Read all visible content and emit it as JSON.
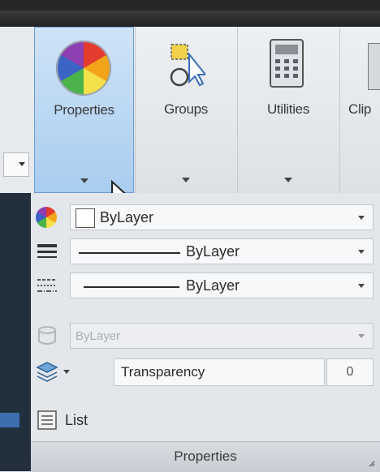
{
  "ribbon": {
    "buttons": [
      {
        "label": "Properties",
        "icon": "color-wheel-icon"
      },
      {
        "label": "Groups",
        "icon": "groups-icon"
      },
      {
        "label": "Utilities",
        "icon": "calculator-icon"
      },
      {
        "label": "Clip",
        "icon": "clipboard-icon"
      }
    ]
  },
  "panel": {
    "color": {
      "value": "ByLayer",
      "icon": "color-wheel-icon"
    },
    "lineweight": {
      "value": "ByLayer",
      "icon": "lineweight-icon"
    },
    "linetype": {
      "value": "ByLayer",
      "icon": "linetype-icon"
    },
    "plotstyle": {
      "value": "ByLayer",
      "icon": "plot-style-icon"
    },
    "transparency": {
      "label": "Transparency",
      "value": "0",
      "icon": "layers-icon"
    },
    "list": {
      "label": "List",
      "icon": "list-icon"
    },
    "title": "Properties"
  },
  "colors": {
    "selected_bg": "#a9cdf0",
    "selected_border": "#6d9bd1"
  }
}
